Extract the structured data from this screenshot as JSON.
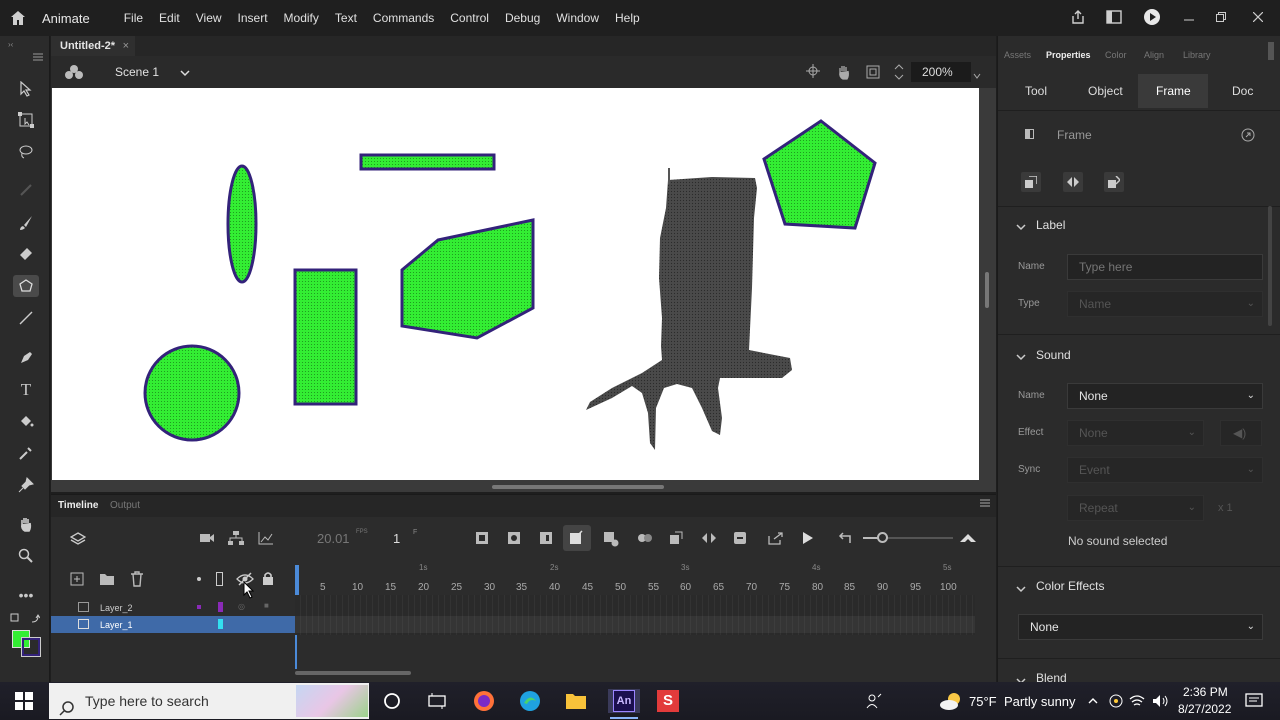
{
  "app": {
    "name": "Animate",
    "menu": [
      "File",
      "Edit",
      "View",
      "Insert",
      "Modify",
      "Text",
      "Commands",
      "Control",
      "Debug",
      "Window",
      "Help"
    ]
  },
  "document": {
    "tab_label": "Untitled-2*",
    "tab_close": "×"
  },
  "scene": {
    "label": "Scene 1",
    "zoom": "200%"
  },
  "timeline": {
    "tab_active": "Timeline",
    "tab_other": "Output",
    "fps": "20.01",
    "fps_unit": "FPS",
    "frame": "1",
    "frame_unit": "F",
    "seconds": [
      "1s",
      "2s",
      "3s",
      "4s",
      "5s"
    ],
    "frame_ticks": [
      "5",
      "10",
      "15",
      "20",
      "25",
      "30",
      "35",
      "40",
      "45",
      "50",
      "55",
      "60",
      "65",
      "70",
      "75",
      "80",
      "85",
      "90",
      "95",
      "100"
    ],
    "layers": [
      {
        "name": "Layer_2",
        "selected": false
      },
      {
        "name": "Layer_1",
        "selected": true
      }
    ]
  },
  "panel": {
    "tabs": [
      "Assets",
      "Properties",
      "Color",
      "Align",
      "Library"
    ],
    "active_tab": "Properties",
    "subtabs": [
      "Tool",
      "Object",
      "Frame",
      "Doc"
    ],
    "active_subtab": "Frame",
    "frame_title": "Frame",
    "label_section": {
      "title": "Label",
      "name_label": "Name",
      "name_placeholder": "Type here",
      "type_label": "Type",
      "type_value": "Name"
    },
    "sound_section": {
      "title": "Sound",
      "name_label": "Name",
      "name_value": "None",
      "effect_label": "Effect",
      "effect_value": "None",
      "sync_label": "Sync",
      "sync_value": "Event",
      "repeat_value": "Repeat",
      "repeat_count": "x 1",
      "status": "No sound selected"
    },
    "color_effects": {
      "title": "Color Effects",
      "value": "None"
    },
    "blend": {
      "title": "Blend"
    }
  },
  "colors": {
    "fill": "#33ee33",
    "stroke": "#33227a",
    "accent_selection": "#3f6aa8"
  },
  "taskbar": {
    "search_placeholder": "Type here to search",
    "weather_temp": "75°F",
    "weather_text": "Partly sunny",
    "time": "2:36 PM",
    "date": "8/27/2022"
  }
}
